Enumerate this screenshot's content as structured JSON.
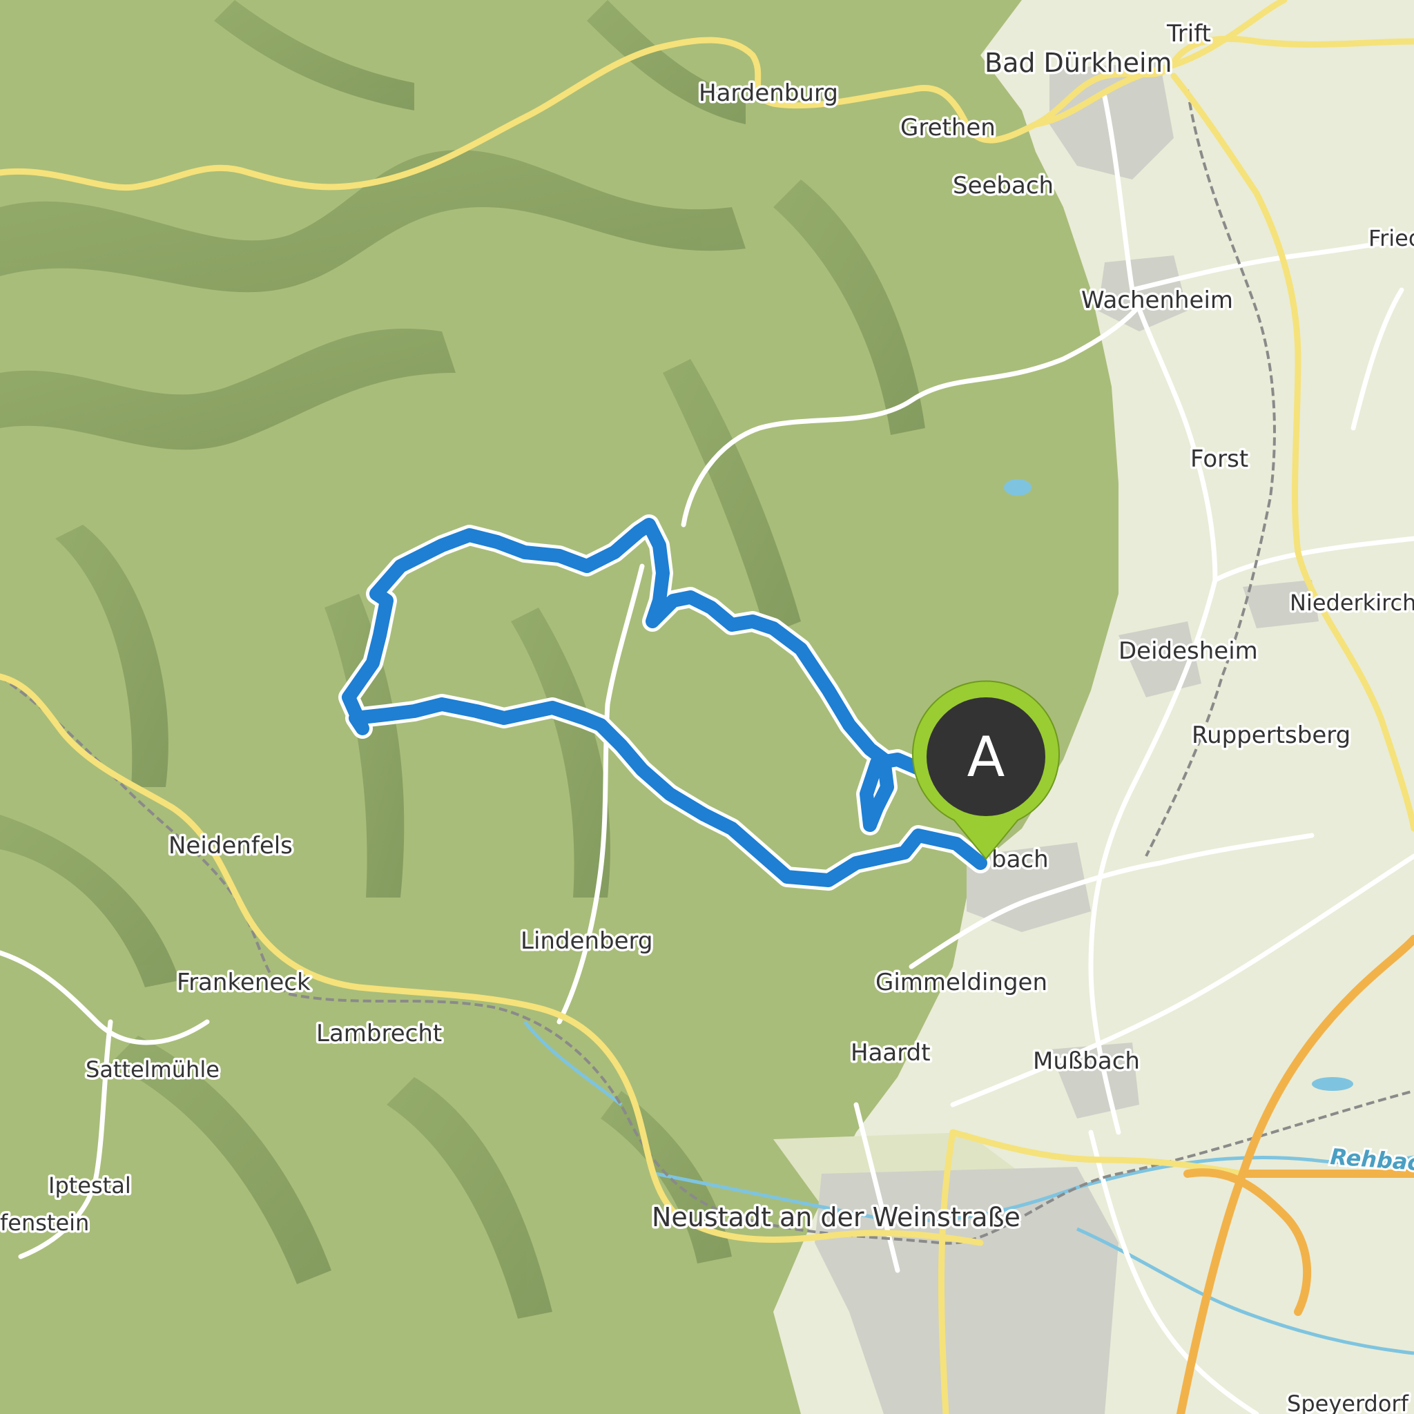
{
  "map": {
    "colors": {
      "forest": "#a9bd7a",
      "plain": "#e9ecd8",
      "urban": "#cfd0c8",
      "route": "#1e7fd3",
      "marker_fill": "#333333",
      "marker_ring": "#9acd32",
      "yellow_road": "#f5e27a",
      "orange_road": "#f2b24a",
      "water": "#7ec4e0"
    },
    "marker": {
      "letter": "A",
      "icon": "map-pin-icon"
    },
    "river": "Rehbach",
    "places": [
      {
        "id": "trift",
        "label": "Trift"
      },
      {
        "id": "bad-durkheim",
        "label": "Bad Dürkheim"
      },
      {
        "id": "hardenburg",
        "label": "Hardenburg"
      },
      {
        "id": "grethen",
        "label": "Grethen"
      },
      {
        "id": "seebach",
        "label": "Seebach"
      },
      {
        "id": "fried",
        "label": "Fried"
      },
      {
        "id": "wachenheim",
        "label": "Wachenheim"
      },
      {
        "id": "forst",
        "label": "Forst"
      },
      {
        "id": "niederkirchen",
        "label": "Niederkirch"
      },
      {
        "id": "deidesheim",
        "label": "Deidesheim"
      },
      {
        "id": "ruppertsberg",
        "label": "Ruppertsberg"
      },
      {
        "id": "bach",
        "label": "bach"
      },
      {
        "id": "neidenfels",
        "label": "Neidenfels"
      },
      {
        "id": "lindenberg",
        "label": "Lindenberg"
      },
      {
        "id": "frankeneck",
        "label": "Frankeneck"
      },
      {
        "id": "gimmeldingen",
        "label": "Gimmeldingen"
      },
      {
        "id": "lambrecht",
        "label": "Lambrecht"
      },
      {
        "id": "haardt",
        "label": "Haardt"
      },
      {
        "id": "mussbach",
        "label": "Mußbach"
      },
      {
        "id": "sattelmuhle",
        "label": "Sattelmühle"
      },
      {
        "id": "iptestal",
        "label": "Iptestal"
      },
      {
        "id": "fenstein",
        "label": "fenstein"
      },
      {
        "id": "neustadt",
        "label": "Neustadt an der Weinstraße"
      },
      {
        "id": "speyerdorf",
        "label": "Speyerdorf"
      }
    ]
  }
}
